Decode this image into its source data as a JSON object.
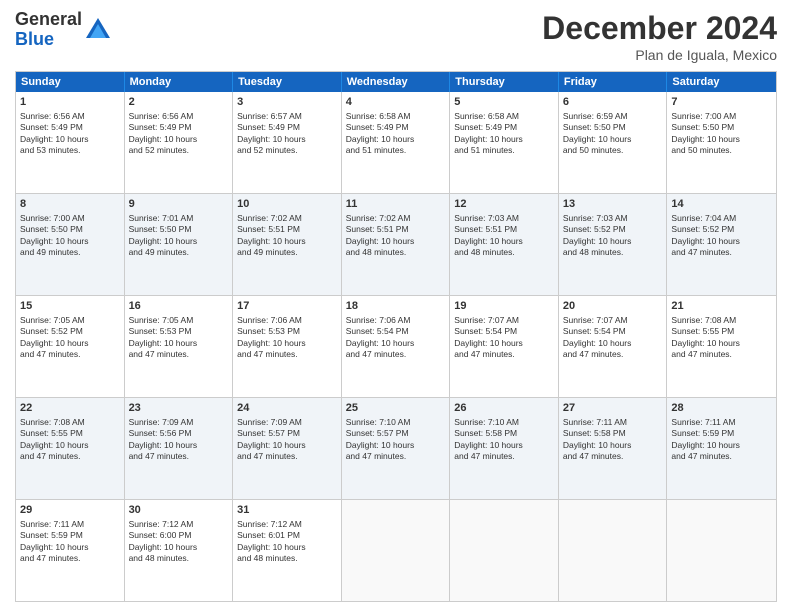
{
  "header": {
    "logo_general": "General",
    "logo_blue": "Blue",
    "month_title": "December 2024",
    "location": "Plan de Iguala, Mexico"
  },
  "days_of_week": [
    "Sunday",
    "Monday",
    "Tuesday",
    "Wednesday",
    "Thursday",
    "Friday",
    "Saturday"
  ],
  "weeks": [
    [
      {
        "day": "1",
        "lines": [
          "Sunrise: 6:56 AM",
          "Sunset: 5:49 PM",
          "Daylight: 10 hours",
          "and 53 minutes."
        ]
      },
      {
        "day": "2",
        "lines": [
          "Sunrise: 6:56 AM",
          "Sunset: 5:49 PM",
          "Daylight: 10 hours",
          "and 52 minutes."
        ]
      },
      {
        "day": "3",
        "lines": [
          "Sunrise: 6:57 AM",
          "Sunset: 5:49 PM",
          "Daylight: 10 hours",
          "and 52 minutes."
        ]
      },
      {
        "day": "4",
        "lines": [
          "Sunrise: 6:58 AM",
          "Sunset: 5:49 PM",
          "Daylight: 10 hours",
          "and 51 minutes."
        ]
      },
      {
        "day": "5",
        "lines": [
          "Sunrise: 6:58 AM",
          "Sunset: 5:49 PM",
          "Daylight: 10 hours",
          "and 51 minutes."
        ]
      },
      {
        "day": "6",
        "lines": [
          "Sunrise: 6:59 AM",
          "Sunset: 5:50 PM",
          "Daylight: 10 hours",
          "and 50 minutes."
        ]
      },
      {
        "day": "7",
        "lines": [
          "Sunrise: 7:00 AM",
          "Sunset: 5:50 PM",
          "Daylight: 10 hours",
          "and 50 minutes."
        ]
      }
    ],
    [
      {
        "day": "8",
        "lines": [
          "Sunrise: 7:00 AM",
          "Sunset: 5:50 PM",
          "Daylight: 10 hours",
          "and 49 minutes."
        ]
      },
      {
        "day": "9",
        "lines": [
          "Sunrise: 7:01 AM",
          "Sunset: 5:50 PM",
          "Daylight: 10 hours",
          "and 49 minutes."
        ]
      },
      {
        "day": "10",
        "lines": [
          "Sunrise: 7:02 AM",
          "Sunset: 5:51 PM",
          "Daylight: 10 hours",
          "and 49 minutes."
        ]
      },
      {
        "day": "11",
        "lines": [
          "Sunrise: 7:02 AM",
          "Sunset: 5:51 PM",
          "Daylight: 10 hours",
          "and 48 minutes."
        ]
      },
      {
        "day": "12",
        "lines": [
          "Sunrise: 7:03 AM",
          "Sunset: 5:51 PM",
          "Daylight: 10 hours",
          "and 48 minutes."
        ]
      },
      {
        "day": "13",
        "lines": [
          "Sunrise: 7:03 AM",
          "Sunset: 5:52 PM",
          "Daylight: 10 hours",
          "and 48 minutes."
        ]
      },
      {
        "day": "14",
        "lines": [
          "Sunrise: 7:04 AM",
          "Sunset: 5:52 PM",
          "Daylight: 10 hours",
          "and 47 minutes."
        ]
      }
    ],
    [
      {
        "day": "15",
        "lines": [
          "Sunrise: 7:05 AM",
          "Sunset: 5:52 PM",
          "Daylight: 10 hours",
          "and 47 minutes."
        ]
      },
      {
        "day": "16",
        "lines": [
          "Sunrise: 7:05 AM",
          "Sunset: 5:53 PM",
          "Daylight: 10 hours",
          "and 47 minutes."
        ]
      },
      {
        "day": "17",
        "lines": [
          "Sunrise: 7:06 AM",
          "Sunset: 5:53 PM",
          "Daylight: 10 hours",
          "and 47 minutes."
        ]
      },
      {
        "day": "18",
        "lines": [
          "Sunrise: 7:06 AM",
          "Sunset: 5:54 PM",
          "Daylight: 10 hours",
          "and 47 minutes."
        ]
      },
      {
        "day": "19",
        "lines": [
          "Sunrise: 7:07 AM",
          "Sunset: 5:54 PM",
          "Daylight: 10 hours",
          "and 47 minutes."
        ]
      },
      {
        "day": "20",
        "lines": [
          "Sunrise: 7:07 AM",
          "Sunset: 5:54 PM",
          "Daylight: 10 hours",
          "and 47 minutes."
        ]
      },
      {
        "day": "21",
        "lines": [
          "Sunrise: 7:08 AM",
          "Sunset: 5:55 PM",
          "Daylight: 10 hours",
          "and 47 minutes."
        ]
      }
    ],
    [
      {
        "day": "22",
        "lines": [
          "Sunrise: 7:08 AM",
          "Sunset: 5:55 PM",
          "Daylight: 10 hours",
          "and 47 minutes."
        ]
      },
      {
        "day": "23",
        "lines": [
          "Sunrise: 7:09 AM",
          "Sunset: 5:56 PM",
          "Daylight: 10 hours",
          "and 47 minutes."
        ]
      },
      {
        "day": "24",
        "lines": [
          "Sunrise: 7:09 AM",
          "Sunset: 5:57 PM",
          "Daylight: 10 hours",
          "and 47 minutes."
        ]
      },
      {
        "day": "25",
        "lines": [
          "Sunrise: 7:10 AM",
          "Sunset: 5:57 PM",
          "Daylight: 10 hours",
          "and 47 minutes."
        ]
      },
      {
        "day": "26",
        "lines": [
          "Sunrise: 7:10 AM",
          "Sunset: 5:58 PM",
          "Daylight: 10 hours",
          "and 47 minutes."
        ]
      },
      {
        "day": "27",
        "lines": [
          "Sunrise: 7:11 AM",
          "Sunset: 5:58 PM",
          "Daylight: 10 hours",
          "and 47 minutes."
        ]
      },
      {
        "day": "28",
        "lines": [
          "Sunrise: 7:11 AM",
          "Sunset: 5:59 PM",
          "Daylight: 10 hours",
          "and 47 minutes."
        ]
      }
    ],
    [
      {
        "day": "29",
        "lines": [
          "Sunrise: 7:11 AM",
          "Sunset: 5:59 PM",
          "Daylight: 10 hours",
          "and 47 minutes."
        ]
      },
      {
        "day": "30",
        "lines": [
          "Sunrise: 7:12 AM",
          "Sunset: 6:00 PM",
          "Daylight: 10 hours",
          "and 48 minutes."
        ]
      },
      {
        "day": "31",
        "lines": [
          "Sunrise: 7:12 AM",
          "Sunset: 6:01 PM",
          "Daylight: 10 hours",
          "and 48 minutes."
        ]
      },
      {
        "day": "",
        "lines": []
      },
      {
        "day": "",
        "lines": []
      },
      {
        "day": "",
        "lines": []
      },
      {
        "day": "",
        "lines": []
      }
    ]
  ]
}
